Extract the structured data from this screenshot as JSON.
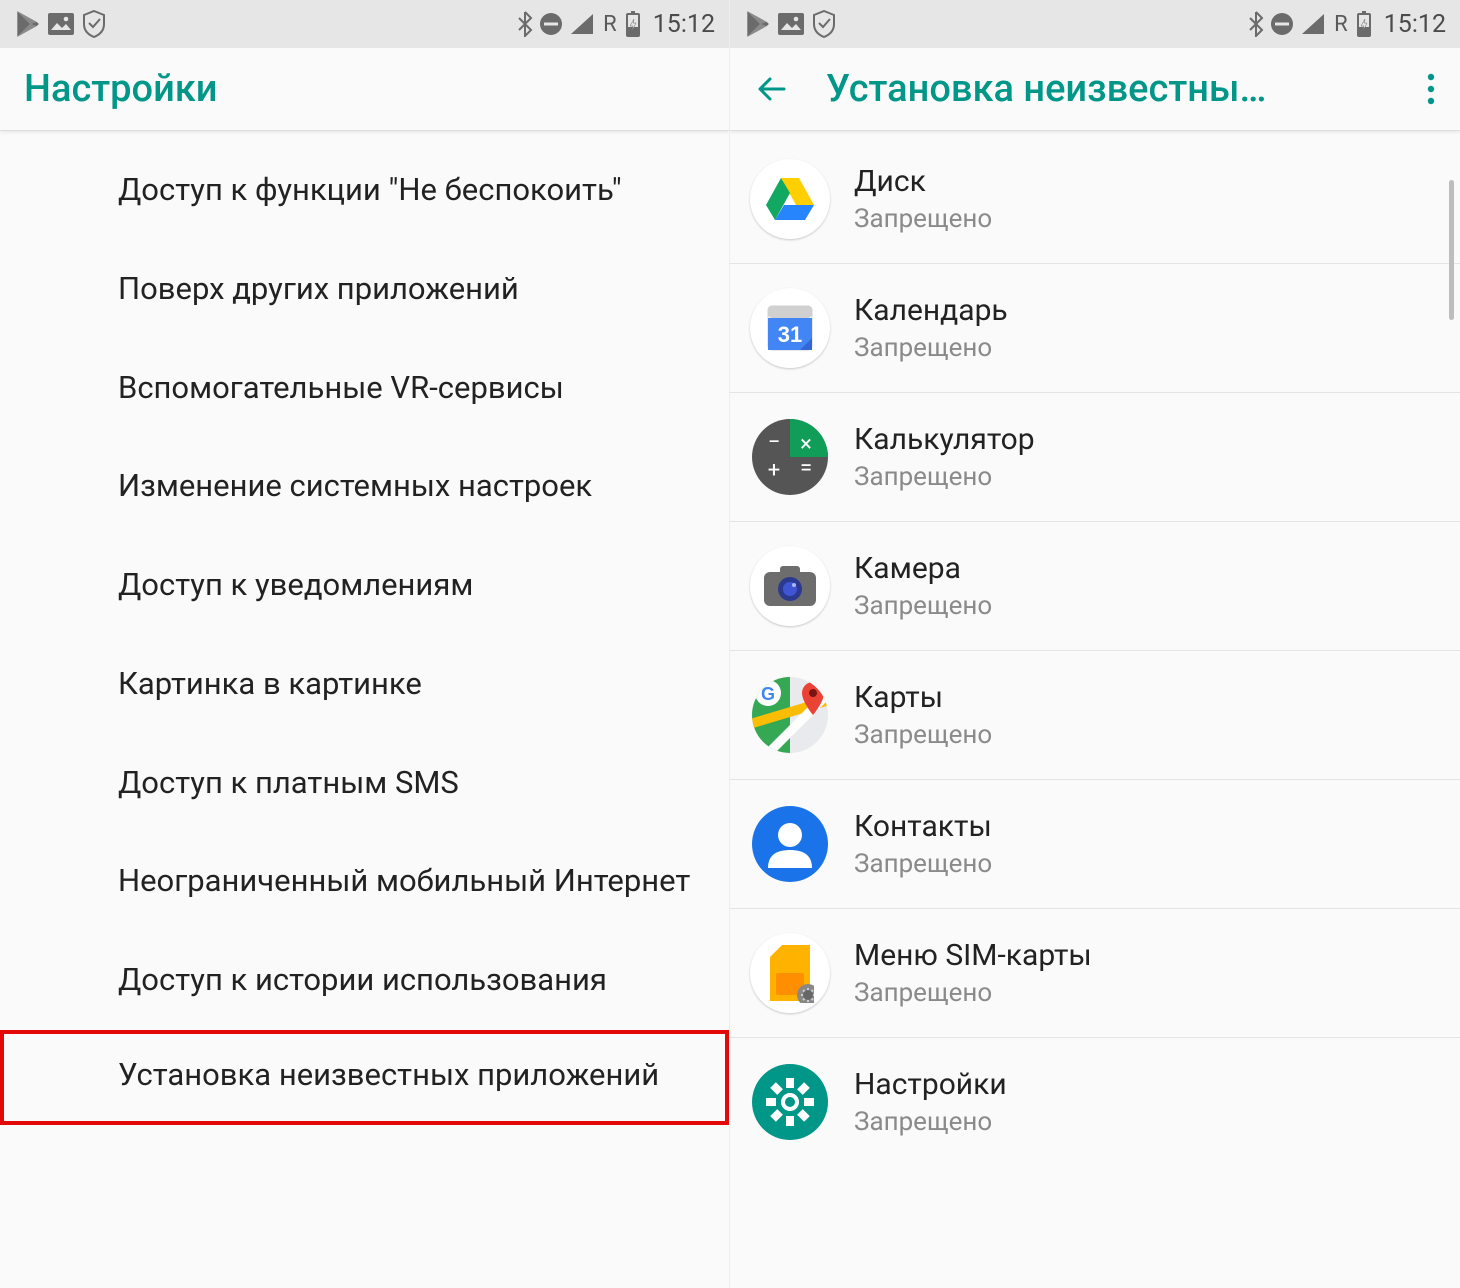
{
  "statusbar": {
    "time": "15:12",
    "roaming_label": "R"
  },
  "left": {
    "title": "Настройки",
    "items": [
      "Доступ к функции \"Не беспокоить\"",
      "Поверх других приложений",
      "Вспомогательные VR-сервисы",
      "Изменение системных настроек",
      "Доступ к уведомлениям",
      "Картинка в картинке",
      "Доступ к платным SMS",
      "Неограниченный мобильный Интернет",
      "Доступ к истории использования",
      "Установка неизвестных приложений"
    ],
    "highlighted_index": 9
  },
  "right": {
    "title": "Установка неизвестны…",
    "apps": [
      {
        "name": "Диск",
        "status": "Запрещено",
        "icon": "drive"
      },
      {
        "name": "Календарь",
        "status": "Запрещено",
        "icon": "calendar",
        "calendar_day": "31"
      },
      {
        "name": "Калькулятор",
        "status": "Запрещено",
        "icon": "calculator"
      },
      {
        "name": "Камера",
        "status": "Запрещено",
        "icon": "camera"
      },
      {
        "name": "Карты",
        "status": "Запрещено",
        "icon": "maps"
      },
      {
        "name": "Контакты",
        "status": "Запрещено",
        "icon": "contacts"
      },
      {
        "name": "Меню SIM-карты",
        "status": "Запрещено",
        "icon": "sim"
      },
      {
        "name": "Настройки",
        "status": "Запрещено",
        "icon": "settings"
      }
    ]
  },
  "colors": {
    "accent": "#009688",
    "highlight": "#e30909"
  }
}
